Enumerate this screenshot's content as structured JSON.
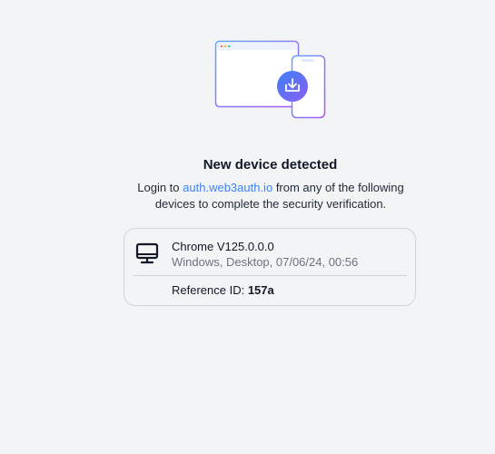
{
  "heading": {
    "title": "New device detected"
  },
  "instructions": {
    "prefix": "Login to",
    "link": "auth.web3auth.io",
    "suffix": "from any of the following devices to complete the security verification."
  },
  "device_card": {
    "icon": "desktop-monitor-icon",
    "name": "Chrome V125.0.0.0",
    "meta": "Windows, Desktop, 07/06/24, 00:56",
    "reference_label": "Reference ID:",
    "reference_value": "157a"
  },
  "illustration": {
    "icon": "download-to-device-icon"
  },
  "colors": {
    "background": "#f3f4f6",
    "link": "#3b82f6",
    "gradient_start": "#60a5fa",
    "gradient_end": "#a855f7"
  }
}
